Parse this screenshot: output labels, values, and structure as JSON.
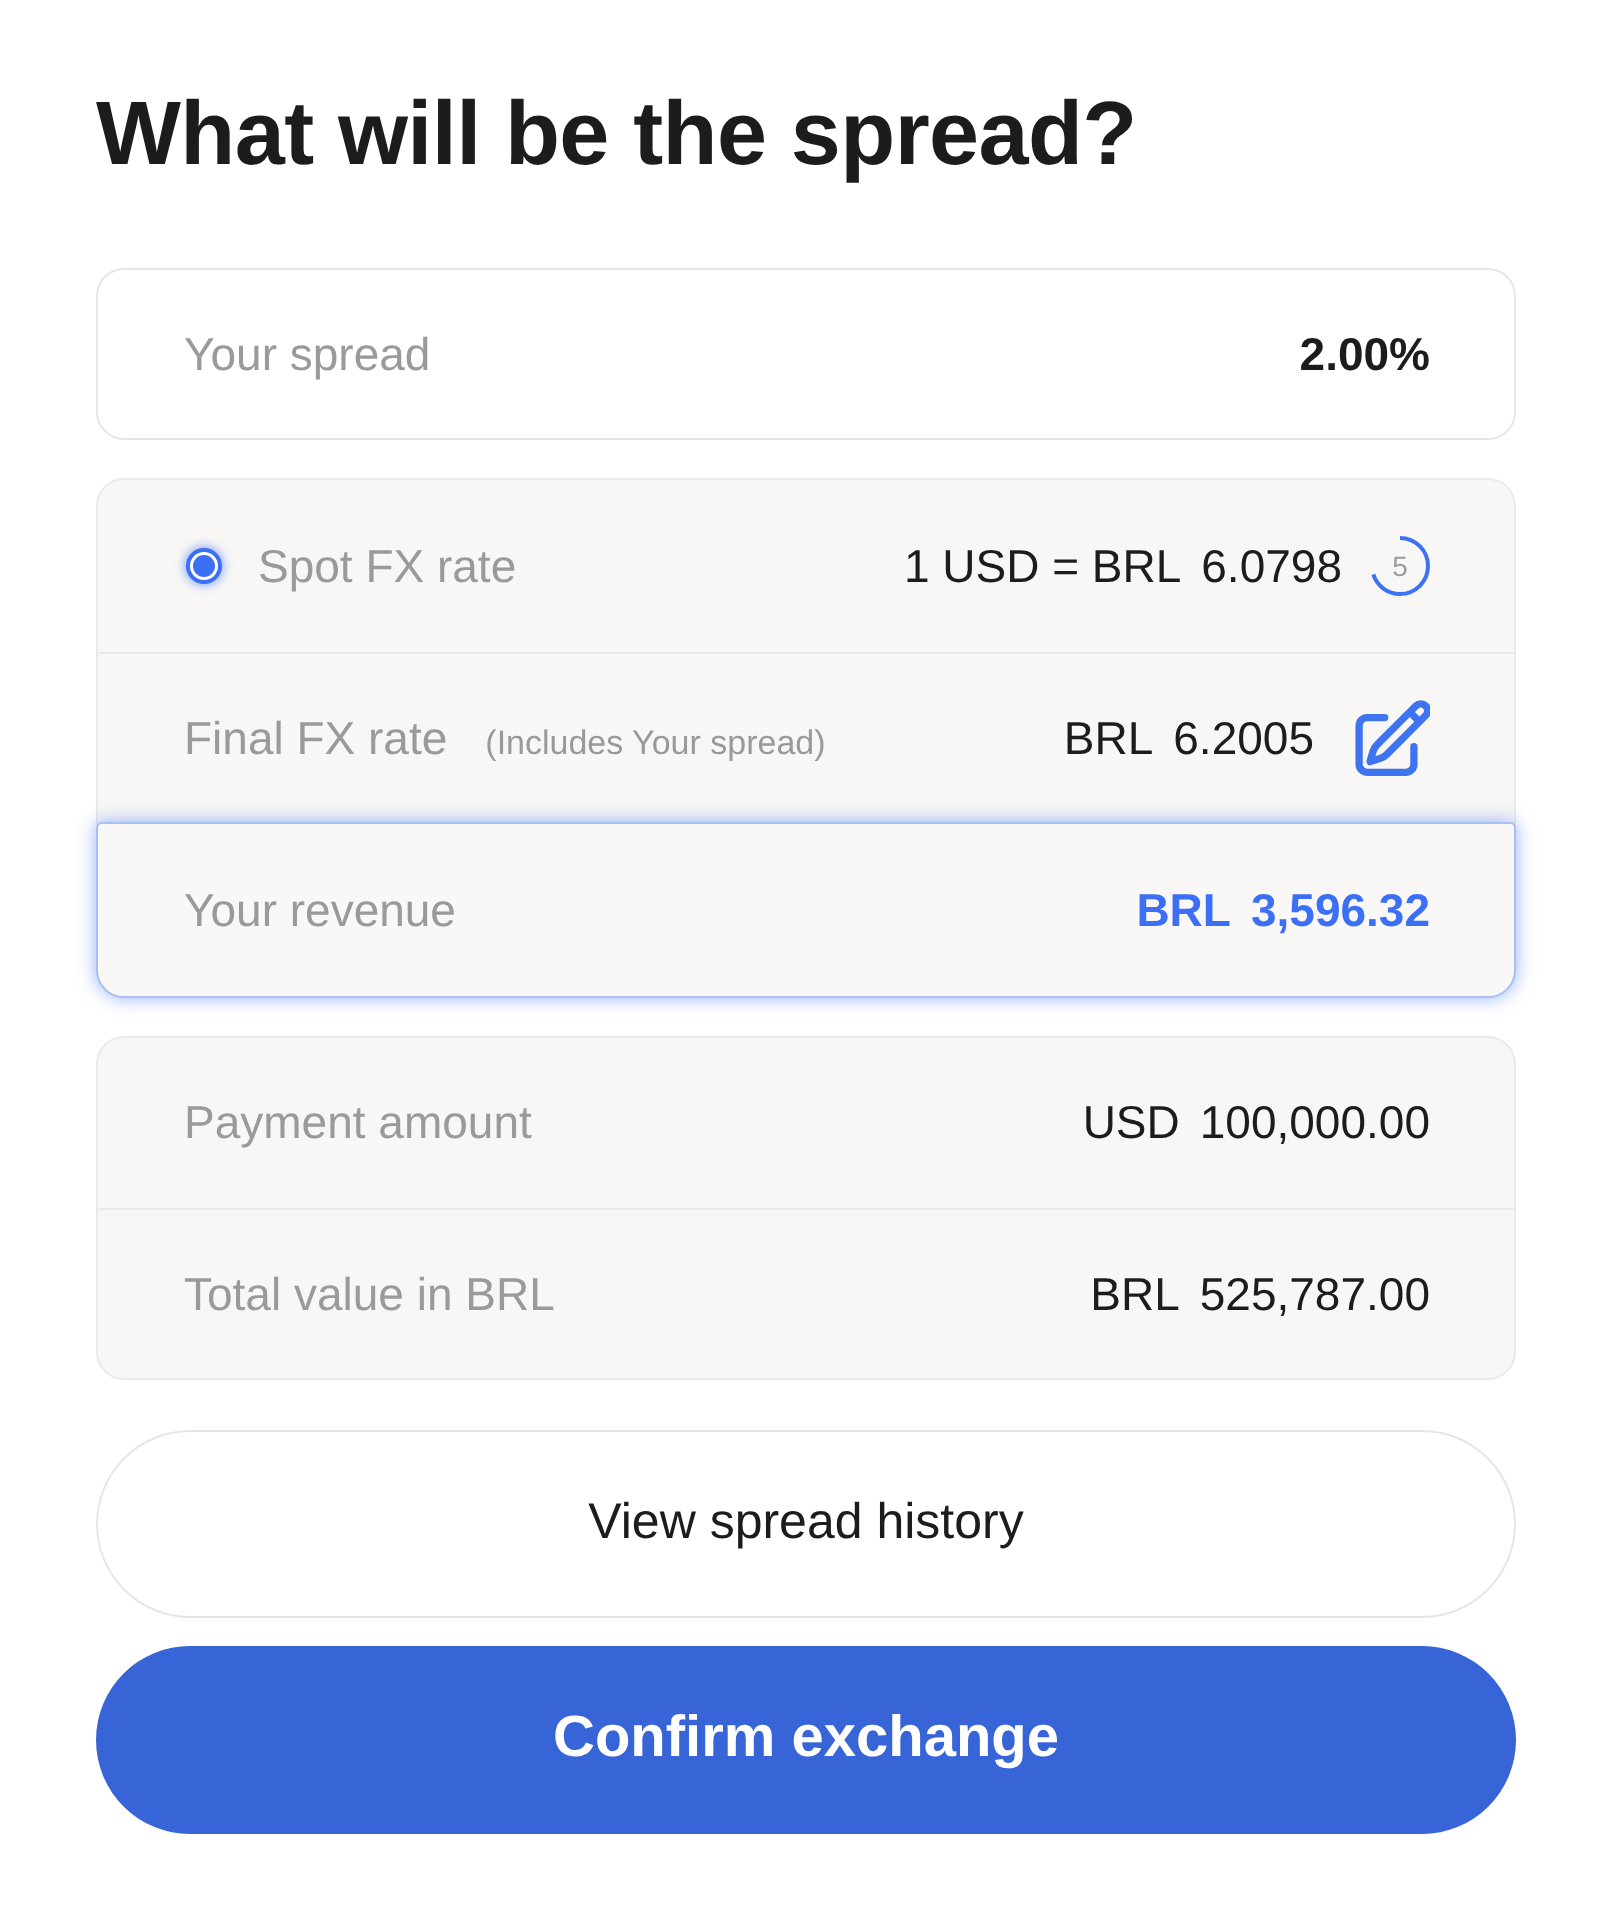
{
  "title": "What will be the spread?",
  "spread": {
    "label": "Your spread",
    "value": "2.00%"
  },
  "rates": [
    {
      "kind": "radio",
      "label": "Spot FX rate",
      "selected": true,
      "unit": "1 USD = BRL",
      "amount": "6.0798",
      "countdown": {
        "text": "5",
        "level": 0.7
      }
    },
    {
      "kind": "editable",
      "label": "Final FX rate",
      "note": "(Includes Your spread)",
      "unit": "BRL",
      "amount": "6.2005"
    },
    {
      "kind": "result",
      "label": "Your revenue",
      "unit": "BRL",
      "amount": "3,596.32",
      "highlighted": true
    }
  ],
  "totals": [
    {
      "label": "Payment amount",
      "unit": "USD",
      "amount": "100,000.00"
    },
    {
      "label": "Total value in BRL",
      "unit": "BRL",
      "amount": "525,787.00"
    }
  ],
  "buttons": [
    {
      "kind": "secondary",
      "label": "View spread history"
    },
    {
      "kind": "primary",
      "label": "Confirm exchange"
    }
  ]
}
